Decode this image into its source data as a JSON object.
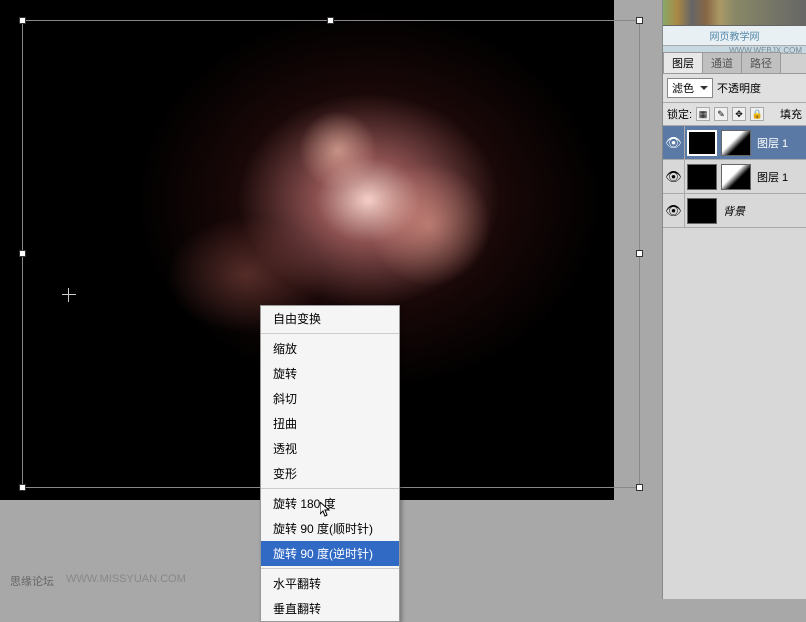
{
  "context_menu": {
    "items": [
      {
        "label": "自由变换",
        "sep_after": true
      },
      {
        "label": "缩放"
      },
      {
        "label": "旋转"
      },
      {
        "label": "斜切"
      },
      {
        "label": "扭曲"
      },
      {
        "label": "透视"
      },
      {
        "label": "变形",
        "sep_after": true
      },
      {
        "label": "旋转 180 度"
      },
      {
        "label": "旋转 90 度(顺时针)"
      },
      {
        "label": "旋转 90 度(逆时针)",
        "highlighted": true,
        "sep_after": true
      },
      {
        "label": "水平翻转"
      },
      {
        "label": "垂直翻转"
      }
    ]
  },
  "banner": {
    "text": "网页教学网",
    "url": "WWW.WEBJX.COM"
  },
  "layers_panel": {
    "tabs": [
      {
        "label": "图层",
        "active": true
      },
      {
        "label": "通道"
      },
      {
        "label": "路径"
      }
    ],
    "blend_mode": "滤色",
    "opacity_label": "不透明度",
    "lock_label": "锁定:",
    "fill_label": "填充",
    "layers": [
      {
        "name": "图层 1",
        "has_mask": true,
        "selected": true,
        "visible": true
      },
      {
        "name": "图层 1",
        "has_mask": true,
        "selected": false,
        "visible": true
      },
      {
        "name": "背景",
        "has_mask": false,
        "selected": false,
        "visible": true,
        "is_bg": true
      }
    ]
  },
  "footer": {
    "forum": "思缘论坛",
    "url": "WWW.MISSYUAN.COM"
  }
}
